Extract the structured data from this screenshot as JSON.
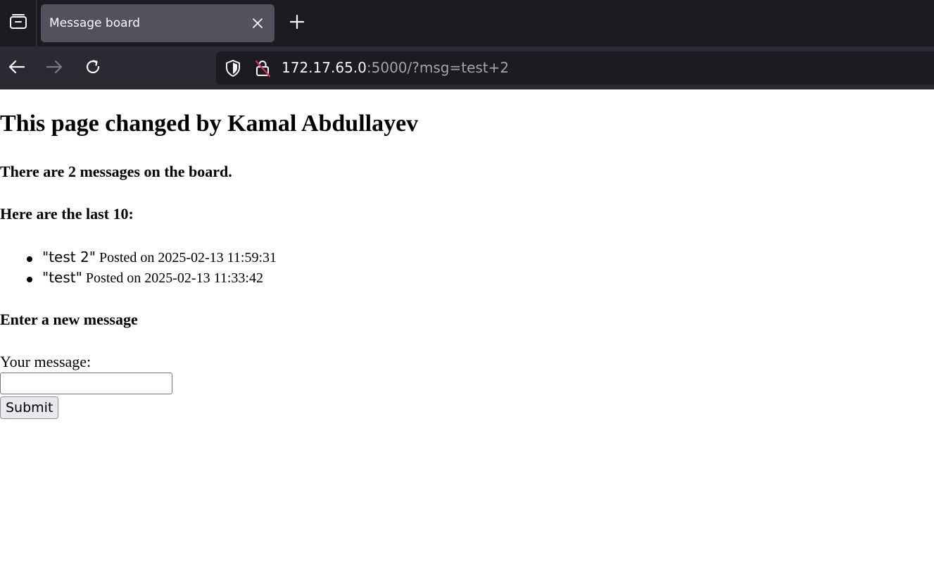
{
  "browser": {
    "tab_title": "Message board",
    "url_host": "172.17.65.0",
    "url_rest": ":5000/?msg=test+2"
  },
  "page": {
    "title": "This page changed by Kamal Abdullayev",
    "count_text": "There are 2 messages on the board.",
    "list_heading": "Here are the last 10:",
    "messages": [
      {
        "text": "\"test 2\"",
        "meta": "Posted on 2025-02-13 11:59:31"
      },
      {
        "text": "\"test\"",
        "meta": "Posted on 2025-02-13 11:33:42"
      }
    ],
    "form_heading": "Enter a new message",
    "form_label": "Your message:",
    "input_value": "",
    "submit_label": "Submit"
  },
  "icons": {
    "sidebar": "tab-overview-icon",
    "close": "close-icon",
    "new_tab": "plus-icon",
    "back": "back-arrow-icon",
    "forward": "forward-arrow-icon",
    "reload": "reload-icon",
    "shield": "shield-icon",
    "lock": "insecure-lock-icon"
  },
  "colors": {
    "chrome_bg": "#1c1b22",
    "nav_bg": "#2b2a33",
    "tab_active": "#52525e",
    "insecure_slash": "#e22850"
  }
}
